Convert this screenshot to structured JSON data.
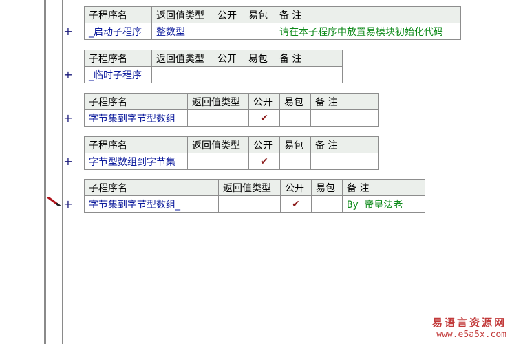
{
  "headers": {
    "name": "子程序名",
    "return_type": "返回值类型",
    "public": "公开",
    "easy_pack": "易包",
    "remark": "备 注"
  },
  "subroutines": [
    {
      "name": "_启动子程序",
      "return_type": "整数型",
      "public_check": "",
      "remark": "请在本子程序中放置易模块初始化代码"
    },
    {
      "name": "_临时子程序",
      "return_type": "",
      "public_check": "",
      "remark": ""
    },
    {
      "name": "字节集到字节型数组",
      "return_type": "",
      "public_check": "✔",
      "remark": ""
    },
    {
      "name": "字节型数组到字节集",
      "return_type": "",
      "public_check": "✔",
      "remark": ""
    },
    {
      "name": "字节集到字节型数组_",
      "return_type": "",
      "public_check": "✔",
      "remark": "By 帝皇法老"
    }
  ],
  "expand_symbol": "+",
  "watermark": {
    "title": "易语言资源网",
    "url": "www.e5a5x.com"
  },
  "colors": {
    "header_bg": "#ebefeb",
    "name_text": "#0b1a9c",
    "remark_text": "#0e8a1a",
    "check_mark": "#8b1a1a",
    "watermark": "#c23a3a"
  }
}
